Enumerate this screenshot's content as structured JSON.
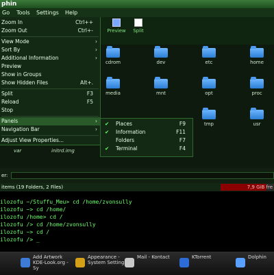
{
  "window_title": "phin",
  "menubar": [
    "Go",
    "Tools",
    "Settings",
    "Help"
  ],
  "toolbar": {
    "preview": "Preview",
    "split": "Split"
  },
  "view_menu": [
    {
      "label": "Zoom In",
      "shortcut": "Ctrl++"
    },
    {
      "label": "Zoom Out",
      "shortcut": "Ctrl+-"
    },
    {
      "label": "View Mode",
      "arrow": "›"
    },
    {
      "label": "Sort By",
      "arrow": "›"
    },
    {
      "label": "Additional Information",
      "arrow": "›"
    },
    {
      "label": "Preview"
    },
    {
      "label": "Show in Groups"
    },
    {
      "label": "Show Hidden Files",
      "shortcut": "Alt+."
    },
    {
      "label": "Split",
      "shortcut": "F3"
    },
    {
      "label": "Reload",
      "shortcut": "F5"
    },
    {
      "label": "Stop"
    },
    {
      "label": "Panels",
      "arrow": "›"
    },
    {
      "label": "Navigation Bar",
      "arrow": "›"
    },
    {
      "label": "Adjust View Properties..."
    }
  ],
  "panels_submenu": [
    {
      "label": "Places",
      "shortcut": "F9"
    },
    {
      "label": "Information",
      "shortcut": "F11"
    },
    {
      "label": "Folders",
      "shortcut": "F7"
    },
    {
      "label": "Terminal",
      "shortcut": "F4"
    }
  ],
  "folders": [
    {
      "name": "cdrom"
    },
    {
      "name": "dev"
    },
    {
      "name": "etc"
    },
    {
      "name": "home"
    },
    {
      "name": "media"
    },
    {
      "name": "mnt"
    },
    {
      "name": "opt"
    },
    {
      "name": "proc"
    },
    {
      "name": "tmp"
    },
    {
      "name": "usr"
    }
  ],
  "files": [
    "var",
    "initrd.img"
  ],
  "filter_label": "er:",
  "status": {
    "items": "items (19 Folders, 2 Files)",
    "free": "7,9 GiB fre"
  },
  "terminal": [
    "ilozofu ~/Stuffu_Meu> cd /home/zvonsully",
    "ilozofu ~> cd /home/",
    "ilozofu /home> cd /",
    "ilozofu /> cd /home/zvonsully",
    "ilozofu ~> cd /",
    "ilozofu /> _"
  ],
  "taskbar": [
    {
      "label": "Add Artwork KDE-Look.org - Sy",
      "color": "#3d7bd6"
    },
    {
      "label": "Appearance - System Settings",
      "color": "#d4a017"
    },
    {
      "label": "Mail - Kontact",
      "color": "#c9c9c9"
    },
    {
      "label": "KTorrent",
      "color": "#2d6cd6"
    },
    {
      "label": "Dolphin",
      "color": "#5aa0ff"
    }
  ]
}
